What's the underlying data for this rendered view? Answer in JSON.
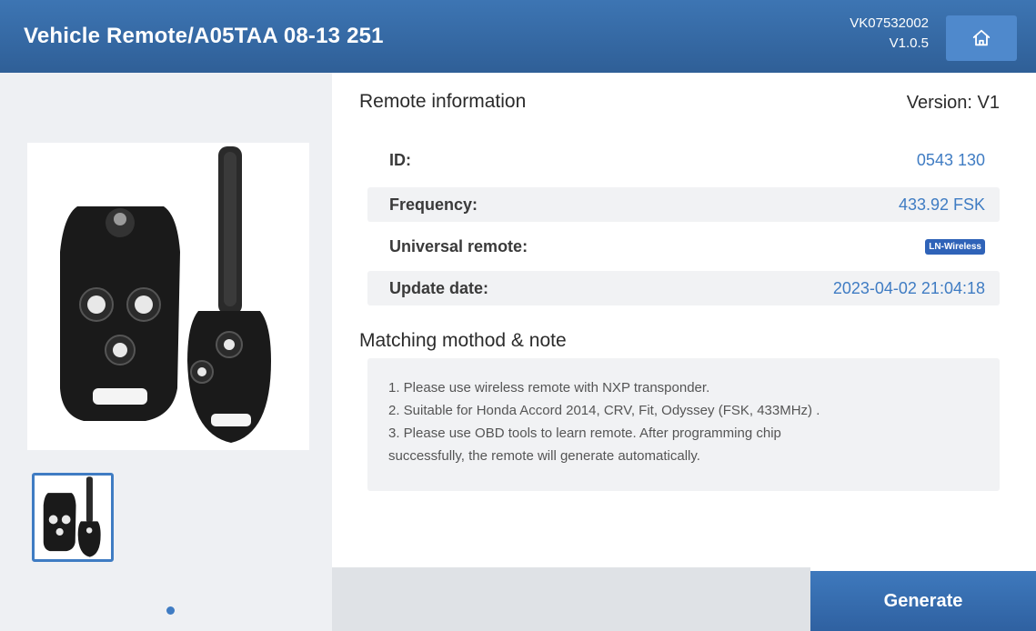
{
  "header": {
    "title": "Vehicle Remote/A05TAA 08-13 251",
    "serial": "VK07532002",
    "version": "V1.0.5",
    "home_icon": "home-icon"
  },
  "remote_info": {
    "title": "Remote information",
    "version_label": "Version: V1",
    "rows": [
      {
        "label": "ID:",
        "value": "0543 130"
      },
      {
        "label": "Frequency:",
        "value": "433.92 FSK"
      },
      {
        "label": "Universal remote:",
        "value": "LN-Wireless"
      },
      {
        "label": "Update date:",
        "value": "2023-04-02 21:04:18"
      }
    ]
  },
  "note": {
    "title": "Matching mothod & note",
    "lines": [
      "1. Please use wireless remote with NXP transponder.",
      "2. Suitable for Honda Accord 2014,  CRV,  Fit,  Odyssey (FSK, 433MHz) .",
      "3. Please use OBD tools to learn remote. After programming chip",
      "successfully, the remote will generate automatically."
    ]
  },
  "footer": {
    "generate_label": "Generate"
  },
  "colors": {
    "header": "#3d75b3",
    "accent": "#3f7cc3",
    "left_panel": "#eef0f3"
  }
}
